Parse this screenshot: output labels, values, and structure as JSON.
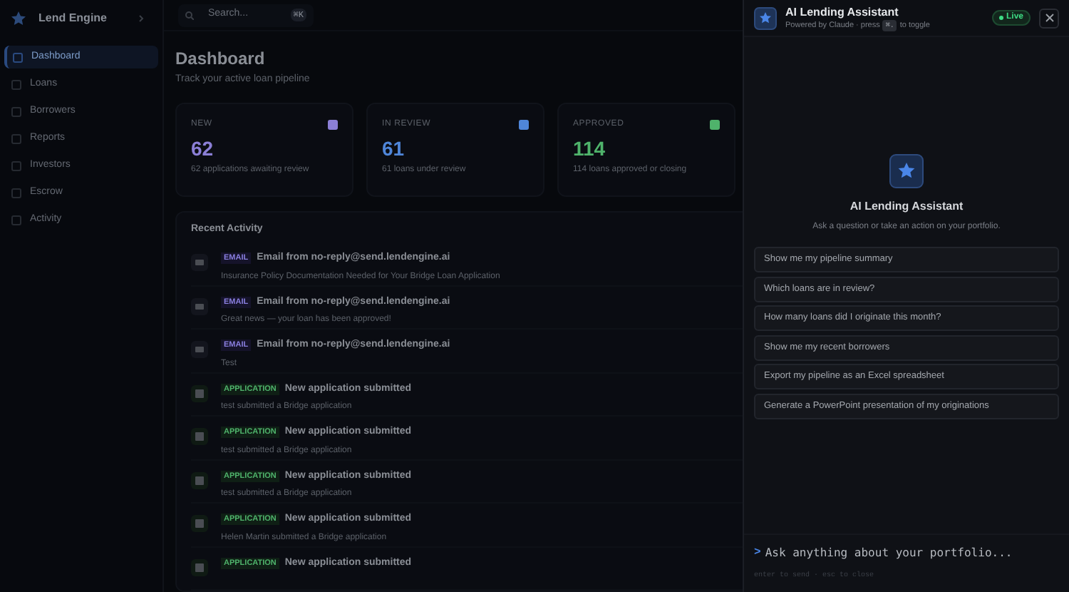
{
  "app": {
    "brand": "Lend Engine",
    "search_placeholder": "Search...",
    "search_shortcut": "⌘K"
  },
  "sidebar": {
    "items": [
      {
        "label": "Dashboard",
        "selected": true
      },
      {
        "label": "Loans",
        "selected": false
      },
      {
        "label": "Borrowers",
        "selected": false
      },
      {
        "label": "Reports",
        "selected": false
      },
      {
        "label": "Investors",
        "selected": false
      },
      {
        "label": "Escrow",
        "selected": false
      },
      {
        "label": "Activity",
        "selected": false
      }
    ]
  },
  "page": {
    "title": "Dashboard",
    "subtitle": "Track your active loan pipeline",
    "stats": [
      {
        "label": "NEW",
        "value": "62",
        "note": "62 applications awaiting review",
        "color": "#8b7fd6"
      },
      {
        "label": "IN REVIEW",
        "value": "61",
        "note": "61 loans under review",
        "color": "#4f86d9"
      },
      {
        "label": "APPROVED",
        "value": "114",
        "note": "114 loans approved or closing",
        "color": "#4fb36b"
      }
    ],
    "activity": {
      "title": "Recent Activity",
      "items": [
        {
          "kind": "email",
          "tag": "EMAIL",
          "title": "Email from no-reply@send.lendengine.ai",
          "detail": "Insurance Policy Documentation Needed for Your Bridge Loan Application"
        },
        {
          "kind": "email",
          "tag": "EMAIL",
          "title": "Email from no-reply@send.lendengine.ai",
          "detail": "Great news — your loan has been approved!"
        },
        {
          "kind": "email",
          "tag": "EMAIL",
          "title": "Email from no-reply@send.lendengine.ai",
          "detail": "Test"
        },
        {
          "kind": "application",
          "tag": "APPLICATION",
          "title": "New application submitted",
          "detail": "test submitted a Bridge application"
        },
        {
          "kind": "application",
          "tag": "APPLICATION",
          "title": "New application submitted",
          "detail": "test submitted a Bridge application"
        },
        {
          "kind": "application",
          "tag": "APPLICATION",
          "title": "New application submitted",
          "detail": "test submitted a Bridge application"
        },
        {
          "kind": "application",
          "tag": "APPLICATION",
          "title": "New application submitted",
          "detail": "Helen Martin submitted a Bridge application"
        },
        {
          "kind": "application",
          "tag": "APPLICATION",
          "title": "New application submitted"
        }
      ]
    }
  },
  "assistant": {
    "title": "AI Lending Assistant",
    "subtitle_before": "Powered by Claude · press",
    "shortcut": "⌘.",
    "subtitle_after": "to toggle",
    "status": "Live",
    "hero_title": "AI Lending Assistant",
    "hero_subtitle": "Ask a question or take an action on your portfolio.",
    "suggestions": [
      "Show me my pipeline summary",
      "Which loans are in review?",
      "How many loans did I originate this month?",
      "Show me my recent borrowers",
      "Export my pipeline as an Excel spreadsheet",
      "Generate a PowerPoint presentation of my originations"
    ],
    "prompt": ">",
    "placeholder": "Ask anything about your portfolio...",
    "hint": "enter to send · esc to close"
  }
}
